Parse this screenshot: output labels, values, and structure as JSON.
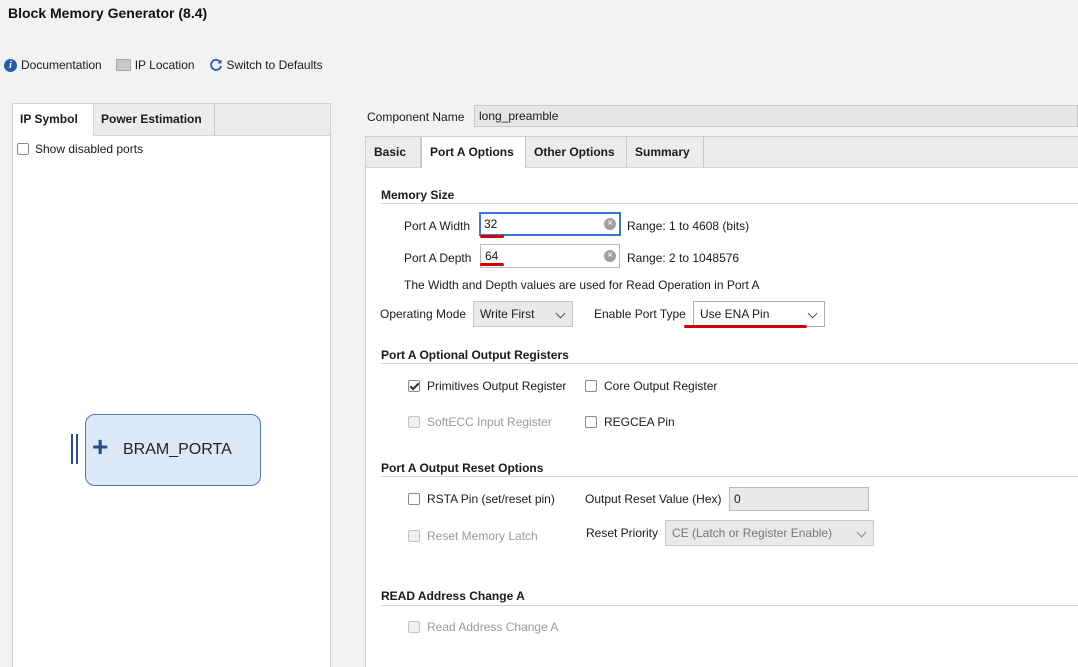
{
  "window": {
    "title": "Block Memory Generator (8.4)"
  },
  "toolbar": {
    "documentation": "Documentation",
    "ip_location": "IP Location",
    "switch_defaults": "Switch to Defaults"
  },
  "left": {
    "tabs": [
      "IP Symbol",
      "Power Estimation"
    ],
    "show_disabled": "Show disabled ports",
    "symbol_label": "BRAM_PORTA"
  },
  "component": {
    "label": "Component Name",
    "value": "long_preamble"
  },
  "tabs": [
    "Basic",
    "Port A Options",
    "Other Options",
    "Summary"
  ],
  "memory_size": {
    "heading": "Memory Size",
    "width_label": "Port A Width",
    "width_value": "32",
    "width_range": "Range: 1 to 4608 (bits)",
    "depth_label": "Port A Depth",
    "depth_value": "64",
    "depth_range": "Range: 2 to 1048576",
    "note": "The Width and Depth values are used for Read Operation in Port A",
    "op_mode_label": "Operating Mode",
    "op_mode_value": "Write First",
    "enable_label": "Enable Port Type",
    "enable_value": "Use ENA Pin"
  },
  "optional_regs": {
    "heading": "Port A Optional Output Registers",
    "prim": "Primitives Output Register",
    "core": "Core Output Register",
    "softecc": "SoftECC Input Register",
    "regcea": "REGCEA Pin"
  },
  "reset": {
    "heading": "Port A Output Reset Options",
    "rsta": "RSTA Pin (set/reset pin)",
    "reset_value_label": "Output Reset Value (Hex)",
    "reset_value": "0",
    "latch": "Reset Memory Latch",
    "priority_label": "Reset Priority",
    "priority_value": "CE (Latch or Register Enable)"
  },
  "read_addr": {
    "heading": "READ Address Change A",
    "option": "Read Address Change A"
  },
  "colors": {
    "accent": "#3a78d3",
    "annotation": "#d40000"
  },
  "icons": [
    "info-icon",
    "folder-icon",
    "refresh-icon",
    "clear-icon",
    "chevron-down-icon",
    "plus-icon"
  ]
}
